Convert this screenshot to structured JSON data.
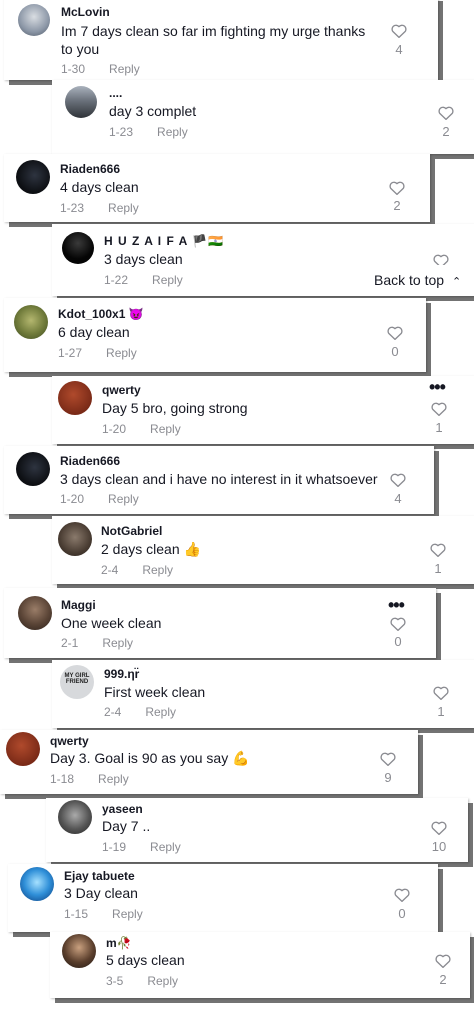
{
  "comments": [
    {
      "user": "McLovin",
      "text": "Im 7 days clean so far im fighting my urge thanks to you",
      "date": "1-30",
      "reply": "Reply",
      "likes": "4"
    },
    {
      "user": "....",
      "text": "day 3 complet",
      "date": "1-23",
      "reply": "Reply",
      "likes": "2"
    },
    {
      "user": "Riaden666",
      "text": "4 days clean",
      "date": "1-23",
      "reply": "Reply",
      "likes": "2"
    },
    {
      "user": "H U Z A I F A 🏴🇮🇳",
      "text": "3 days clean",
      "date": "1-22",
      "reply": "Reply",
      "likes": ""
    },
    {
      "user": "Kdot_100x1 😈",
      "text": "6 day clean",
      "date": "1-27",
      "reply": "Reply",
      "likes": "0"
    },
    {
      "user": "qwerty",
      "text": "Day 5 bro, going strong",
      "date": "1-20",
      "reply": "Reply",
      "likes": "1"
    },
    {
      "user": "Riaden666",
      "text": "3 days clean and i have no interest in it whatsoever",
      "date": "1-20",
      "reply": "Reply",
      "likes": "4"
    },
    {
      "user": "NotGabriel",
      "text": "2 days clean 👍",
      "date": "2-4",
      "reply": "Reply",
      "likes": "1"
    },
    {
      "user": "Maggi",
      "text": "One week clean",
      "date": "2-1",
      "reply": "Reply",
      "likes": "0"
    },
    {
      "user": "999.ηr̈",
      "text": "First week clean",
      "date": "2-4",
      "reply": "Reply",
      "likes": "1"
    },
    {
      "user": "qwerty",
      "text": "Day 3. Goal is 90 as you say 💪",
      "date": "1-18",
      "reply": "Reply",
      "likes": "9"
    },
    {
      "user": "yaseen",
      "text": "Day 7 ..",
      "date": "1-19",
      "reply": "Reply",
      "likes": "10"
    },
    {
      "user": "Ejay tabuete",
      "text": "3 Day clean",
      "date": "1-15",
      "reply": "Reply",
      "likes": "0"
    },
    {
      "user": "m🥀",
      "text": "5 days clean",
      "date": "3-5",
      "reply": "Reply",
      "likes": "2"
    }
  ],
  "back_to_top": "Back to top",
  "avatar_badge": "MY GIRL FRIEND",
  "icons": {
    "like": "heart-outline-icon",
    "more": "more-dots-icon",
    "up": "chevron-up-icon"
  }
}
